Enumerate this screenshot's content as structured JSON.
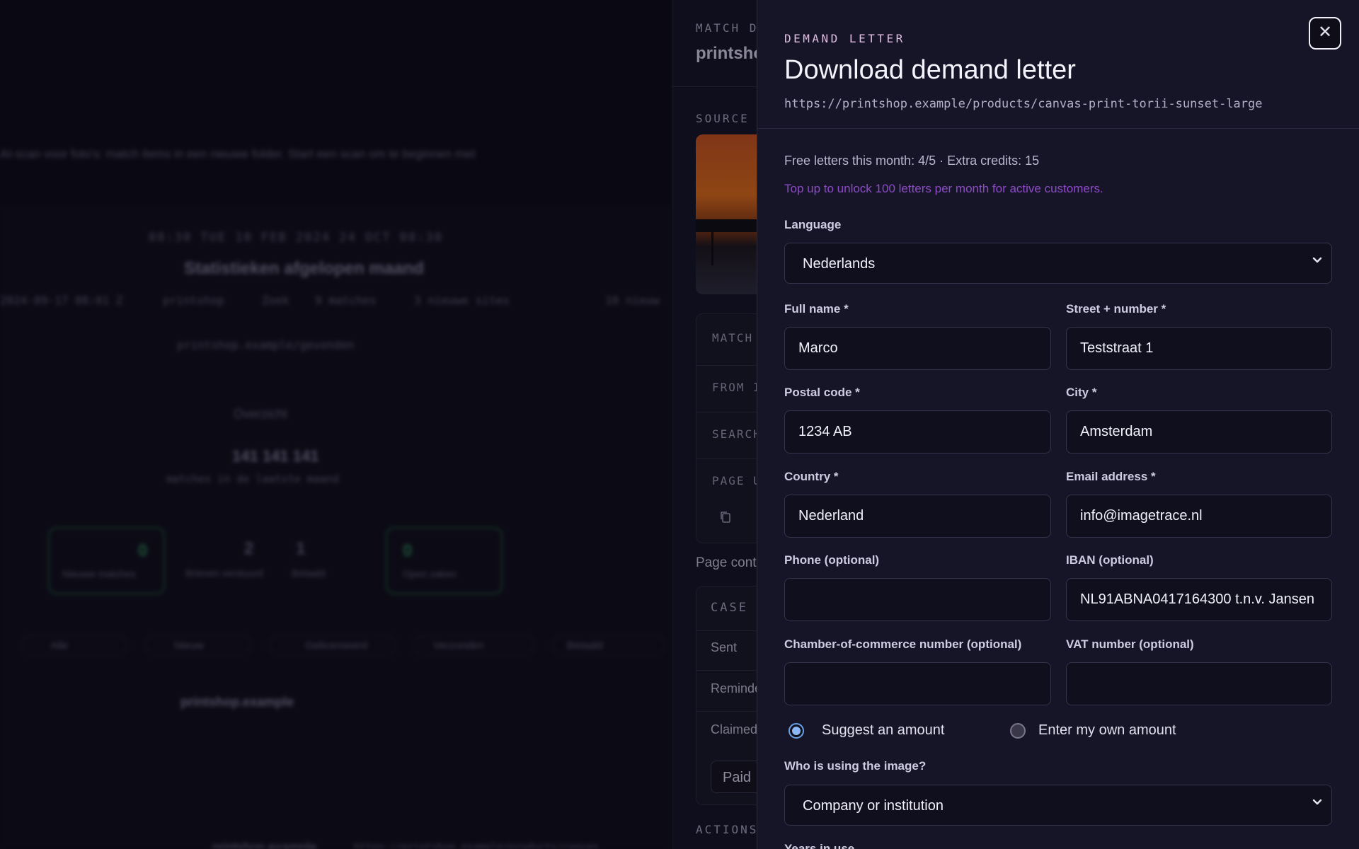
{
  "background": {
    "intro_line": "AI-scan voor foto's: match items in een nieuwe folder. Start een scan om te beginnen met",
    "datetime_line": "08:30 TUE 10 FEB 2024 24 OCT 08:30",
    "heading": "Statistieken afgelopen maand",
    "meta_items": [
      "2024-09-17 08:01 Z",
      "printshop",
      "Zoek",
      "9 matches",
      "3 nieuwe sites",
      "10 nieuw"
    ],
    "link": "printshop.example/gevonden",
    "section": "Overzicht",
    "big_value": "141 141 141",
    "big_sub": "matches in de laatste maand",
    "stats": [
      {
        "value": "0",
        "label": "Nieuwe matches"
      },
      {
        "value": "2",
        "label": "Brieven verstuurd"
      },
      {
        "value": "1",
        "label": "Betaald"
      },
      {
        "value": "0",
        "label": "Open zaken"
      }
    ],
    "filters": [
      "Alle",
      "Nieuw",
      "Gelicenseerd",
      "Verzonden",
      "Betaald"
    ],
    "row_domain": "printshop.example",
    "footer_domain": "printshop.example",
    "footer_path": "https://printshop.example/products/canvas"
  },
  "match_panel": {
    "header_label": "MATCH DE",
    "site_title": "printsho",
    "source_label": "SOURCE",
    "rows": [
      "MATCH",
      "FROM I",
      "SEARCH",
      "PAGE U"
    ],
    "page_text": "Page cont",
    "case": {
      "header": "CASE",
      "rows": [
        "Sent",
        "Reminde",
        "Claimed"
      ],
      "paid_label": "Paid"
    },
    "actions_label": "ACTIONS"
  },
  "modal": {
    "eyebrow": "DEMAND LETTER",
    "title": "Download demand letter",
    "url": "https://printshop.example/products/canvas-print-torii-sunset-large",
    "quota": "Free letters this month: 4/5 · Extra credits: 15",
    "topup": "Top up to unlock 100 letters per month for active customers.",
    "language": {
      "label": "Language",
      "value": "Nederlands"
    },
    "fields": {
      "full_name": {
        "label": "Full name *",
        "value": "Marco",
        "placeholder": ""
      },
      "street": {
        "label": "Street + number *",
        "value": "Teststraat 1",
        "placeholder": ""
      },
      "postal_code": {
        "label": "Postal code *",
        "value": "1234 AB",
        "placeholder": ""
      },
      "city": {
        "label": "City *",
        "value": "Amsterdam",
        "placeholder": ""
      },
      "country": {
        "label": "Country *",
        "value": "Nederland",
        "placeholder": ""
      },
      "email": {
        "label": "Email address *",
        "value": "info@imagetrace.nl",
        "placeholder": ""
      },
      "phone": {
        "label": "Phone (optional)",
        "value": "",
        "placeholder": ""
      },
      "iban": {
        "label": "IBAN (optional)",
        "value": "NL91ABNA0417164300 t.n.v. Jansen",
        "placeholder": ""
      },
      "coc": {
        "label": "Chamber-of-commerce number (optional)",
        "value": "",
        "placeholder": ""
      },
      "vat": {
        "label": "VAT number (optional)",
        "value": "",
        "placeholder": ""
      }
    },
    "amount_mode": {
      "suggest": "Suggest an amount",
      "own": "Enter my own amount",
      "selected": "suggest"
    },
    "usage": {
      "label": "Who is using the image?",
      "value": "Company or institution"
    },
    "years_label": "Years in use"
  }
}
